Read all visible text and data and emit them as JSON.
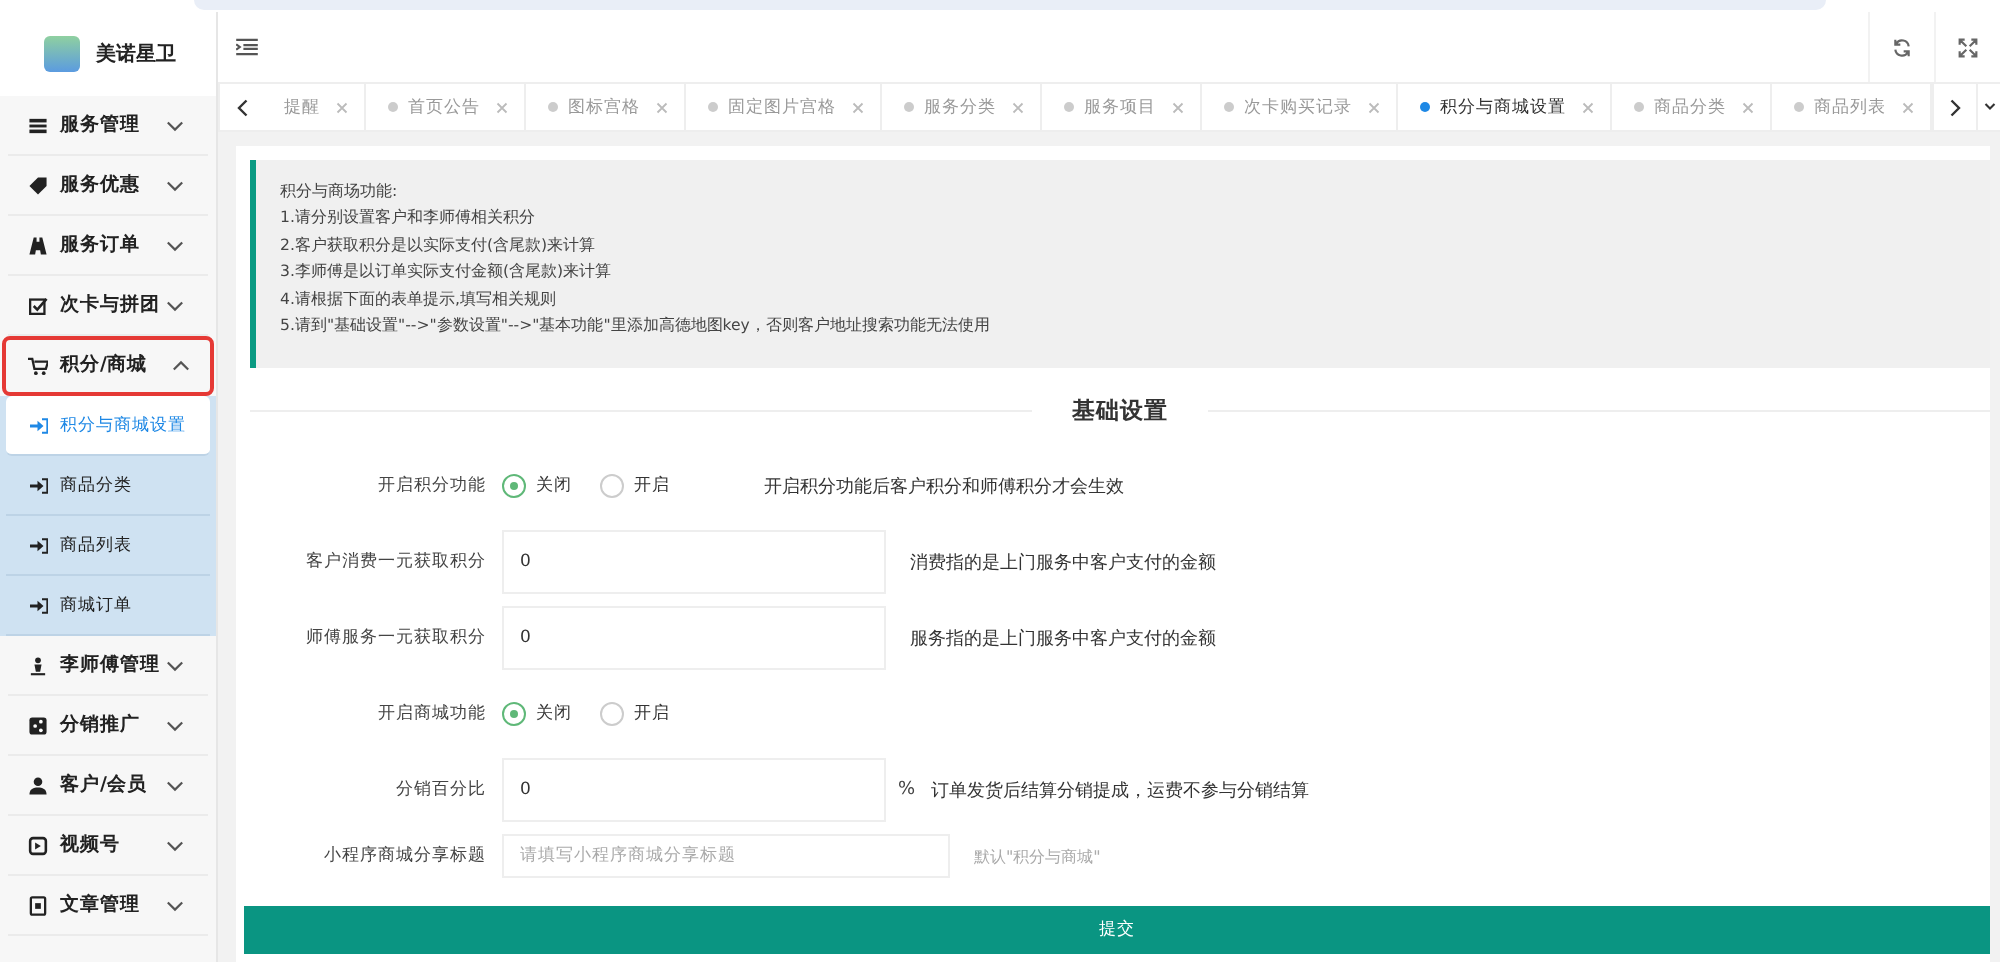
{
  "brand": {
    "name": "美诺星卫"
  },
  "sidebar": {
    "items": [
      {
        "label": "服务管理",
        "expanded": false,
        "highlighted": false
      },
      {
        "label": "服务优惠",
        "expanded": false,
        "highlighted": false
      },
      {
        "label": "服务订单",
        "expanded": false,
        "highlighted": false
      },
      {
        "label": "次卡与拼团",
        "expanded": false,
        "highlighted": false
      },
      {
        "label": "积分/商城",
        "expanded": true,
        "highlighted": true,
        "children": [
          {
            "label": "积分与商城设置",
            "selected": true
          },
          {
            "label": "商品分类",
            "selected": false
          },
          {
            "label": "商品列表",
            "selected": false
          },
          {
            "label": "商城订单",
            "selected": false
          }
        ]
      },
      {
        "label": "李师傅管理",
        "expanded": false,
        "highlighted": false
      },
      {
        "label": "分销推广",
        "expanded": false,
        "highlighted": false
      },
      {
        "label": "客户/会员",
        "expanded": false,
        "highlighted": false
      },
      {
        "label": "视频号",
        "expanded": false,
        "highlighted": false
      },
      {
        "label": "文章管理",
        "expanded": false,
        "highlighted": false
      }
    ]
  },
  "tabs": [
    {
      "label": "提醒",
      "selected": false
    },
    {
      "label": "首页公告",
      "selected": false
    },
    {
      "label": "图标宫格",
      "selected": false
    },
    {
      "label": "固定图片宫格",
      "selected": false
    },
    {
      "label": "服务分类",
      "selected": false
    },
    {
      "label": "服务项目",
      "selected": false
    },
    {
      "label": "次卡购买记录",
      "selected": false
    },
    {
      "label": "积分与商城设置",
      "selected": true
    },
    {
      "label": "商品分类",
      "selected": false
    },
    {
      "label": "商品列表",
      "selected": false
    }
  ],
  "notice": {
    "title": "积分与商场功能:",
    "lines": [
      "1.请分别设置客户和李师傅相关积分",
      "2.客户获取积分是以实际支付(含尾款)来计算",
      "3.李师傅是以订单实际支付金额(含尾款)来计算",
      "4.请根据下面的表单提示,填写相关规则",
      "5.请到\"基础设置\"-->\"参数设置\"-->\"基本功能\"里添加高德地图key，否则客户地址搜索功能无法使用"
    ]
  },
  "section_title": "基础设置",
  "form": [
    {
      "kind": "radio",
      "label": "开启积分功能",
      "options": [
        {
          "label": "关闭",
          "selected": true
        },
        {
          "label": "开启",
          "selected": false
        }
      ],
      "hint": "开启积分功能后客户积分和师傅积分才会生效"
    },
    {
      "kind": "input",
      "label": "客户消费一元获取积分",
      "value": "0",
      "hint": "消费指的是上门服务中客户支付的金额"
    },
    {
      "kind": "input",
      "label": "师傅服务一元获取积分",
      "value": "0",
      "hint": "服务指的是上门服务中客户支付的金额"
    },
    {
      "kind": "radio",
      "label": "开启商城功能",
      "options": [
        {
          "label": "关闭",
          "selected": true
        },
        {
          "label": "开启",
          "selected": false
        }
      ]
    },
    {
      "kind": "input",
      "label": "分销百分比",
      "value": "0",
      "suffix": "%",
      "hint": "订单发货后结算分销提成，运费不参与分销结算"
    },
    {
      "kind": "input",
      "label": "小程序商城分享标题",
      "placeholder": "请填写小程序商城分享标题",
      "hint": "默认\"积分与商城\""
    }
  ],
  "submit": "提交"
}
